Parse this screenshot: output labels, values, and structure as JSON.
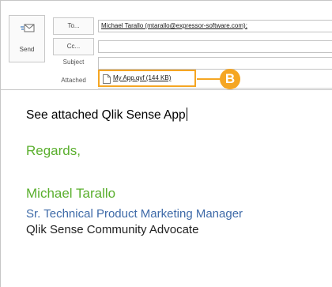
{
  "toolbar": {
    "send_label": "Send"
  },
  "fields": {
    "to_button": "To...",
    "cc_button": "Cc...",
    "subject_label": "Subject",
    "attached_label": "Attached",
    "to_value": "Michael Tarallo (mtarallo@expressor-software.com);",
    "cc_value": "",
    "subject_value": ""
  },
  "attachment": {
    "file_name": "My App.qvf (144 KB)",
    "callout_label": "B"
  },
  "message": {
    "body_line": "See attached Qlik Sense App",
    "regards": "Regards,",
    "signature_name": "Michael Tarallo",
    "signature_title": "Sr. Technical Product Marketing Manager",
    "signature_role": "Qlik Sense Community Advocate"
  },
  "colors": {
    "highlight": "#f5a623",
    "signature_green": "#5aaf2d",
    "signature_blue": "#3e6aa8"
  },
  "icons": {
    "send": "send-envelope-icon",
    "attachment": "document-icon"
  }
}
